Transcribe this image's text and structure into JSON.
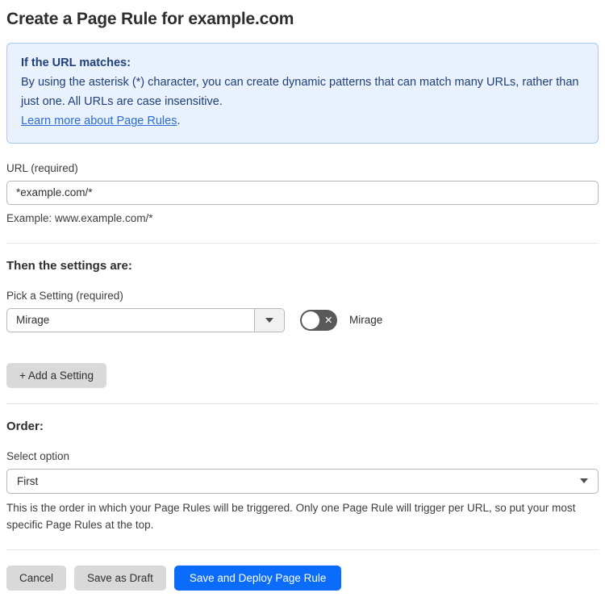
{
  "page": {
    "title": "Create a Page Rule for example.com"
  },
  "info_box": {
    "heading": "If the URL matches:",
    "body": "By using the asterisk (*) character, you can create dynamic patterns that can match many URLs, rather than just one. All URLs are case insensitive.",
    "link_label": "Learn more about Page Rules",
    "link_suffix": "."
  },
  "url_field": {
    "label": "URL (required)",
    "value": "*example.com/*",
    "helper": "Example: www.example.com/*"
  },
  "settings_section": {
    "heading": "Then the settings are:",
    "picker_label": "Pick a Setting (required)",
    "picker_value": "Mirage",
    "toggle_state": "off",
    "toggle_label": "Mirage",
    "add_button_label": "+ Add a Setting"
  },
  "order_section": {
    "heading": "Order:",
    "select_label": "Select option",
    "select_value": "First",
    "helper": "This is the order in which your Page Rules will be triggered. Only one Page Rule will trigger per URL, so put your most specific Page Rules at the top."
  },
  "footer": {
    "cancel_label": "Cancel",
    "save_draft_label": "Save as Draft",
    "save_deploy_label": "Save and Deploy Page Rule"
  },
  "icons": {
    "toggle_x": "✕"
  },
  "colors": {
    "primary_blue": "#0b6cfb",
    "info_bg": "#e8f1fc",
    "info_border": "#a9c9ef",
    "info_text": "#20407c",
    "link_blue": "#2b6cd4",
    "button_gray": "#d9d9d9",
    "toggle_off_gray": "#595959"
  }
}
